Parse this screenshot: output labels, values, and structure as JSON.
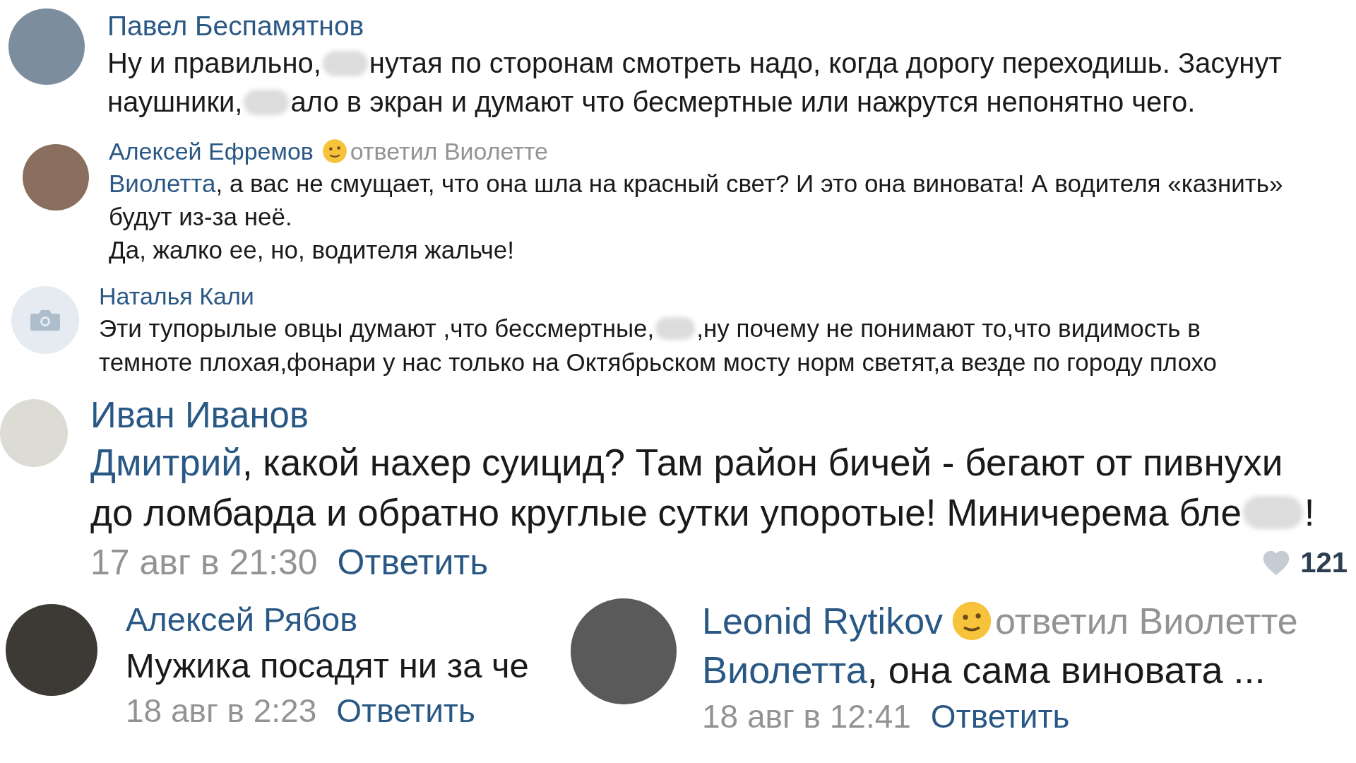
{
  "comments": [
    {
      "name": "Павел Беспамятнов",
      "emoji": false,
      "avatar": {
        "kind": "photo"
      },
      "lines": [
        [
          {
            "kind": "text",
            "text": "Ну и правильно,"
          },
          {
            "kind": "blur"
          },
          {
            "kind": "text",
            "text": "нутая по сторонам смотреть надо, когда дорогу переходишь. Засунут"
          }
        ],
        [
          {
            "kind": "text",
            "text": "наушники,"
          },
          {
            "kind": "blur"
          },
          {
            "kind": "text",
            "text": "ало в экран и думают что бесмертные или нажрутся непонятно чего."
          }
        ]
      ]
    },
    {
      "name": "Алексей Ефремов",
      "emoji": true,
      "reply_to": "ответил Виолетте",
      "avatar": {
        "kind": "photo"
      },
      "lines": [
        [
          {
            "kind": "link",
            "text": "Виолетта"
          },
          {
            "kind": "text",
            "text": ", а вас не смущает, что она шла на красный свет? И это она виновата! А водителя «казнить»"
          }
        ],
        [
          {
            "kind": "text",
            "text": "будут из-за неё."
          }
        ],
        [
          {
            "kind": "text",
            "text": "Да, жалко ее, но, водителя жальче!"
          }
        ]
      ]
    },
    {
      "name": "Наталья Кали",
      "emoji": false,
      "avatar": {
        "kind": "camera"
      },
      "lines": [
        [
          {
            "kind": "text",
            "text": "Эти тупорылые овцы думают ,что бессмертные,"
          },
          {
            "kind": "blur"
          },
          {
            "kind": "text",
            "text": ",ну почему не понимают то,что видимость в"
          }
        ],
        [
          {
            "kind": "text",
            "text": "темноте плохая,фонари у нас только на Октябрьском мосту норм светят,а везде по городу плохо"
          }
        ]
      ]
    },
    {
      "name": "Иван Иванов",
      "emoji": false,
      "avatar": {
        "kind": "photo"
      },
      "lines": [
        [
          {
            "kind": "link",
            "text": "Дмитрий"
          },
          {
            "kind": "text",
            "text": ", какой нахер суицид? Там район бичей - бегают от пивнухи"
          }
        ],
        [
          {
            "kind": "text",
            "text": "до ломбарда и обратно круглые сутки упоротые! Миничерема бле"
          },
          {
            "kind": "blur"
          },
          {
            "kind": "text",
            "text": "!"
          }
        ]
      ],
      "date": "17 авг в 21:30",
      "reply": "Ответить",
      "likes": "121"
    }
  ],
  "bottom_row": [
    {
      "name": "Алексей Рябов",
      "emoji": false,
      "avatar": {
        "kind": "photo"
      },
      "lines": [
        [
          {
            "kind": "text",
            "text": "Мужика посадят ни за че"
          }
        ]
      ],
      "date": "18 авг в 2:23",
      "reply": "Ответить"
    },
    {
      "name": "Leonid Rytikov",
      "emoji": true,
      "reply_to": "ответил Виолетте",
      "avatar": {
        "kind": "photo"
      },
      "lines": [
        [
          {
            "kind": "link",
            "text": "Виолетта"
          },
          {
            "kind": "text",
            "text": ", она сама виновата ..."
          }
        ]
      ],
      "date": "18 авг в 12:41",
      "reply": "Ответить"
    }
  ]
}
